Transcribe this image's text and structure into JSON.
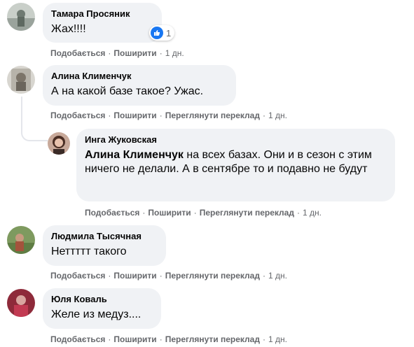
{
  "comments": [
    {
      "author": "Тамара Просяник",
      "text": "Жах!!!!",
      "reaction_count": "1",
      "actions": {
        "like": "Подобається",
        "share": "Поширити",
        "time": "1 дн."
      }
    },
    {
      "author": "Алина Клименчук",
      "text": "А на какой базе такое? Ужас.",
      "actions": {
        "like": "Подобається",
        "share": "Поширити",
        "translate": "Переглянути переклад",
        "time": "1 дн."
      }
    },
    {
      "author": "Инга Жуковская",
      "mention": "Алина Клименчук",
      "text": " на всех базах. Они и в сезон с этим ничего не делали. А в сентябре то и подавно не будут",
      "actions": {
        "like": "Подобається",
        "share": "Поширити",
        "translate": "Переглянути переклад",
        "time": "1 дн."
      }
    },
    {
      "author": "Людмила Тысячная",
      "text": "Неттттт такого",
      "actions": {
        "like": "Подобається",
        "share": "Поширити",
        "translate": "Переглянути переклад",
        "time": "1 дн."
      }
    },
    {
      "author": "Юля Коваль",
      "text": "Желе из медуз....",
      "actions": {
        "like": "Подобається",
        "share": "Поширити",
        "translate": "Переглянути переклад",
        "time": "1 дн."
      }
    }
  ],
  "colors": {
    "bubble": "#f0f2f5",
    "like_blue": "#1877f2",
    "meta_gray": "#65676b"
  }
}
